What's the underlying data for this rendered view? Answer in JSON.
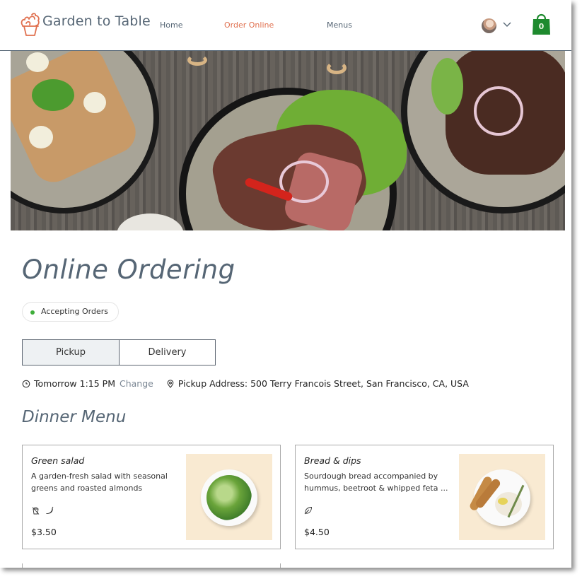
{
  "header": {
    "brand": "Garden to Table",
    "nav": [
      {
        "label": "Home",
        "active": false
      },
      {
        "label": "Order Online",
        "active": true
      },
      {
        "label": "Menus",
        "active": false
      }
    ],
    "cart_count": "0",
    "icons": {
      "logo": "cupcake-logo-icon",
      "avatar": "user-avatar",
      "dropdown": "chevron-down-icon",
      "cart": "shopping-bag-icon"
    }
  },
  "colors": {
    "accent": "#e0704f",
    "heading": "#566675",
    "cart": "#1e8a2e",
    "status_dot": "#3fae3a",
    "card_image_bg": "#f9ead2"
  },
  "main": {
    "title": "Online Ordering",
    "status": "Accepting Orders",
    "tabs": [
      {
        "label": "Pickup",
        "selected": true
      },
      {
        "label": "Delivery",
        "selected": false
      }
    ],
    "time": "Tomorrow 1:15 PM",
    "change_label": "Change",
    "address": "Pickup Address: 500 Terry Francois Street, San Francisco, CA, USA",
    "section_title": "Dinner Menu",
    "items": [
      {
        "name": "Green salad",
        "description": "A garden-fresh salad with seasonal greens and roasted almonds",
        "price": "$3.50",
        "labels": [
          "gluten-free-icon",
          "spicy-pepper-icon"
        ]
      },
      {
        "name": "Bread & dips",
        "description": "Sourdough bread accompanied by hummus, beetroot & whipped feta ...",
        "price": "$4.50",
        "labels": [
          "vegan-leaf-icon"
        ]
      }
    ]
  }
}
